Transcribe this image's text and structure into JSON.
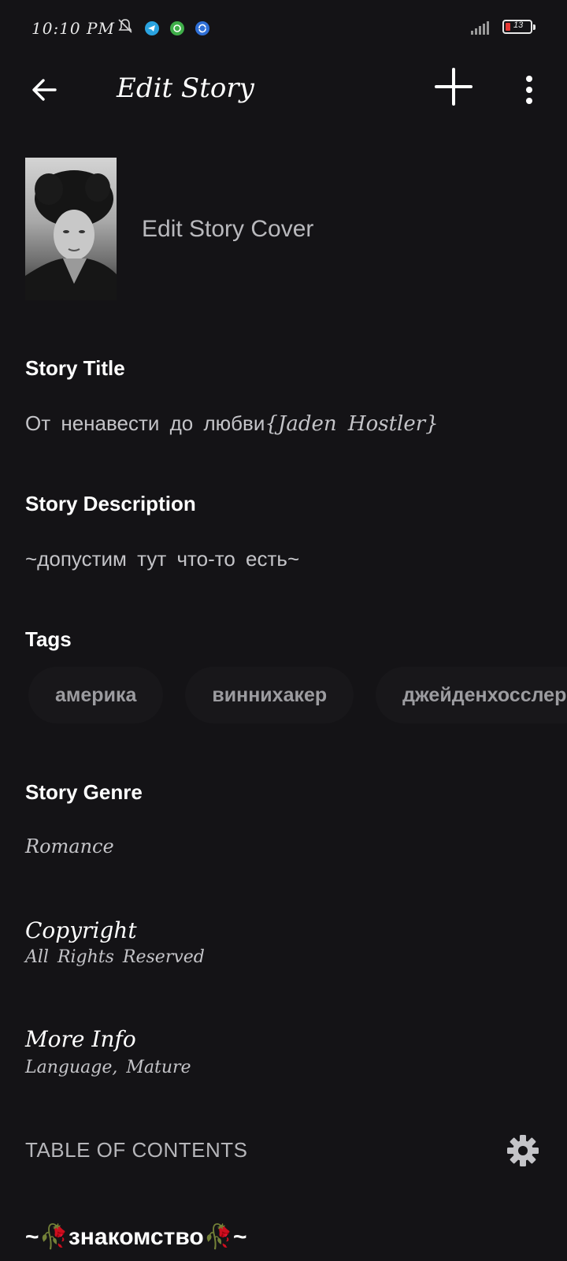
{
  "status_bar": {
    "time": "10:10 PM",
    "battery": "13",
    "icons": [
      "mute-icon",
      "telegram-icon",
      "messenger-icon",
      "sync-icon"
    ]
  },
  "app_bar": {
    "title": "Edit Story",
    "icons": [
      "back-arrow-icon",
      "plus-icon",
      "more-vert-icon"
    ]
  },
  "cover": {
    "label": "Edit Story Cover"
  },
  "story_title": {
    "label": "Story Title",
    "value_plain": "От ненавести до любви",
    "value_script": "{Jaden Hostler}"
  },
  "story_description": {
    "label": "Story Description",
    "value": "~допустим тут что-то есть~"
  },
  "tags": {
    "label": "Tags",
    "items": [
      "америка",
      "виннихакер",
      "джейденхосслер"
    ]
  },
  "story_genre": {
    "label": "Story Genre",
    "value": "Romance"
  },
  "copyright": {
    "label": "Copyright",
    "value": "All Rights Reserved"
  },
  "more_info": {
    "label": "More Info",
    "value": "Language, Mature"
  },
  "toc": {
    "label": "TABLE OF CONTENTS",
    "icon": "gear-icon"
  },
  "chapters": [
    {
      "title": "~🥀знакомство🥀~"
    }
  ],
  "colors": {
    "background": "#141316",
    "tag_background": "#18171a",
    "muted_text": "#c4c4c8",
    "battery_low": "#e53935"
  }
}
